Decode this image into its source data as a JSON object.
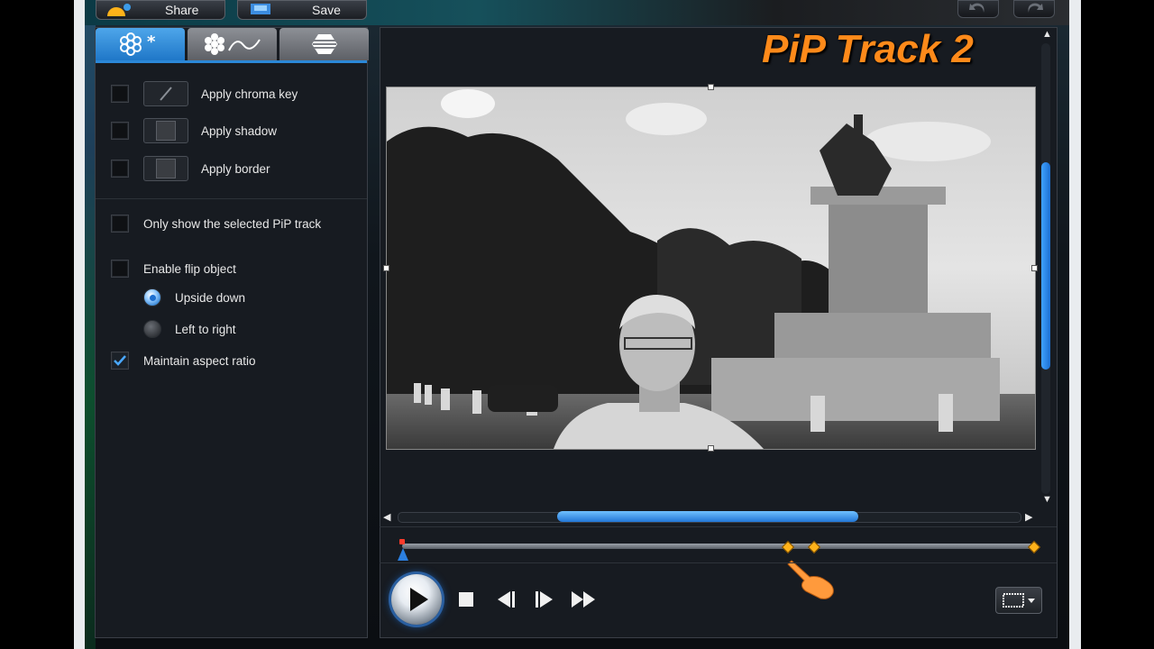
{
  "toolbar": {
    "share_label": "Share",
    "save_label": "Save"
  },
  "left_panel": {
    "tabs": [
      {
        "icon": "effects-star-icon",
        "active": true
      },
      {
        "icon": "motion-path-icon",
        "active": false
      },
      {
        "icon": "shape-mask-icon",
        "active": false
      }
    ],
    "options": {
      "chroma_key": {
        "label": "Apply chroma key",
        "checked": false
      },
      "shadow": {
        "label": "Apply shadow",
        "checked": false
      },
      "border": {
        "label": "Apply border",
        "checked": false
      },
      "only_selected": {
        "label": "Only show the selected PiP track",
        "checked": false
      },
      "flip": {
        "label": "Enable flip object",
        "checked": false
      },
      "upside_down": {
        "label": "Upside down",
        "selected": true
      },
      "left_to_right": {
        "label": "Left to right",
        "selected": false
      },
      "aspect": {
        "label": "Maintain aspect ratio",
        "checked": true
      }
    }
  },
  "preview": {
    "title": "PiP Track 2"
  },
  "colors": {
    "accent": "#2b88d8",
    "title_orange": "#ff8a1a",
    "keyframe": "#ffb21a"
  }
}
